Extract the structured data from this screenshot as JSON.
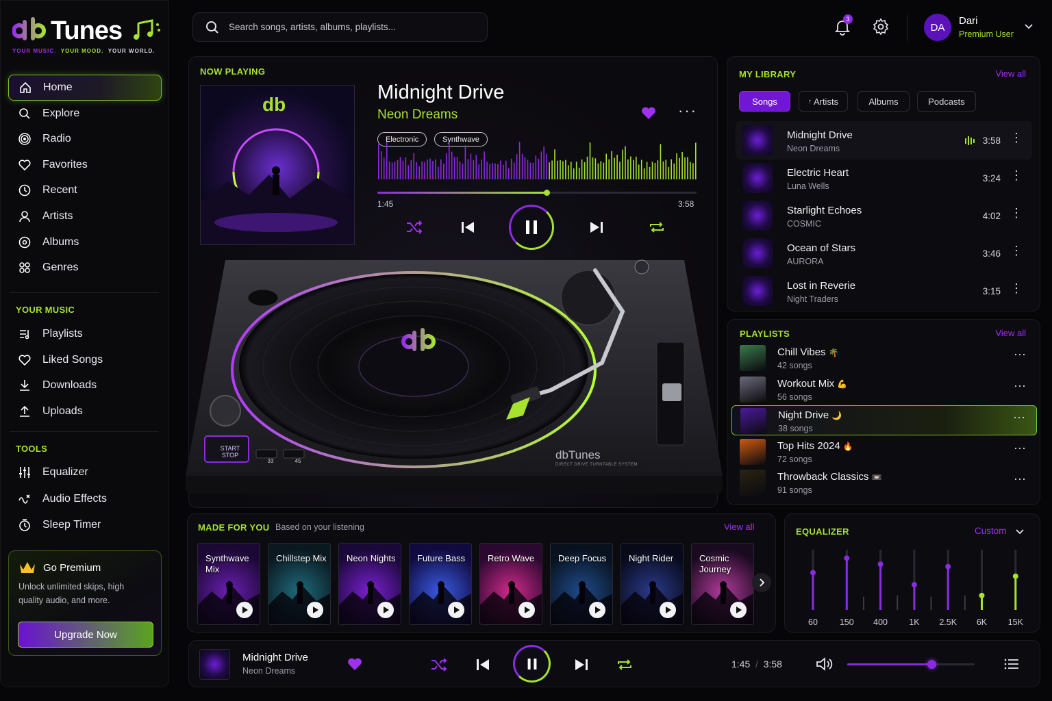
{
  "brand": {
    "name": "Tunes",
    "mark": "db",
    "tagline": [
      "YOUR MUSIC.",
      "YOUR MOOD.",
      "YOUR WORLD."
    ]
  },
  "sidebar": {
    "main_items": [
      {
        "label": "Home",
        "icon": "home-icon",
        "active": true
      },
      {
        "label": "Explore",
        "icon": "search-icon"
      },
      {
        "label": "Radio",
        "icon": "radio-icon"
      },
      {
        "label": "Favorites",
        "icon": "heart-icon"
      },
      {
        "label": "Recent",
        "icon": "clock-icon"
      },
      {
        "label": "Artists",
        "icon": "user-icon"
      },
      {
        "label": "Albums",
        "icon": "disc-icon"
      },
      {
        "label": "Genres",
        "icon": "grid-icon"
      }
    ],
    "your_music_title": "YOUR MUSIC",
    "your_music_items": [
      {
        "label": "Playlists",
        "icon": "playlist-icon"
      },
      {
        "label": "Liked Songs",
        "icon": "heart-icon"
      },
      {
        "label": "Downloads",
        "icon": "download-icon"
      },
      {
        "label": "Uploads",
        "icon": "upload-icon"
      }
    ],
    "tools_title": "TOOLS",
    "tools_items": [
      {
        "label": "Equalizer",
        "icon": "sliders-icon"
      },
      {
        "label": "Audio Effects",
        "icon": "audio-effects-icon"
      },
      {
        "label": "Sleep Timer",
        "icon": "timer-icon"
      }
    ],
    "premium": {
      "title": "Go Premium",
      "description": "Unlock unlimited skips, high quality audio, and more.",
      "button": "Upgrade Now"
    }
  },
  "header": {
    "search_placeholder": "Search songs, artists, albums, playlists...",
    "notification_count": "3",
    "user": {
      "initials": "DA",
      "name": "Dari",
      "role": "Premium User"
    }
  },
  "now_playing": {
    "label": "NOW PLAYING",
    "title": "Midnight Drive",
    "artist": "Neon Dreams",
    "tags": [
      "Electronic",
      "Synthwave"
    ],
    "elapsed": "1:45",
    "duration": "3:58",
    "progress": 0.53,
    "liked": true,
    "cover_mark": "db"
  },
  "turntable": {
    "brand": "dbTunes",
    "subtitle": "DIRECT DRIVE TURNTABLE SYSTEM",
    "start_stop": [
      "START",
      "STOP"
    ],
    "speeds": [
      "33",
      "45"
    ],
    "label_mark": "db"
  },
  "library": {
    "title": "MY LIBRARY",
    "view_all": "View all",
    "tabs": [
      {
        "label": "Songs",
        "active": true
      },
      {
        "label": "Artists"
      },
      {
        "label": "Albums"
      },
      {
        "label": "Podcasts"
      }
    ],
    "songs": [
      {
        "title": "Midnight Drive",
        "artist": "Neon Dreams",
        "duration": "3:58",
        "playing": true
      },
      {
        "title": "Electric Heart",
        "artist": "Luna Wells",
        "duration": "3:24"
      },
      {
        "title": "Starlight Echoes",
        "artist": "COSMIC",
        "duration": "4:02"
      },
      {
        "title": "Ocean of Stars",
        "artist": "AURORA",
        "duration": "3:46"
      },
      {
        "title": "Lost in Reverie",
        "artist": "Night Traders",
        "duration": "3:15"
      }
    ]
  },
  "playlists": {
    "title": "PLAYLISTS",
    "view_all": "View all",
    "items": [
      {
        "name": "Chill Vibes",
        "emoji": "🌴",
        "count": "42 songs",
        "color": "#3a7a4a"
      },
      {
        "name": "Workout Mix",
        "emoji": "💪",
        "count": "56 songs",
        "color": "#6a6a78"
      },
      {
        "name": "Night Drive",
        "emoji": "🌙",
        "count": "38 songs",
        "color": "#4b1a9a",
        "active": true
      },
      {
        "name": "Top Hits 2024",
        "emoji": "🔥",
        "count": "72 songs",
        "color": "#d05a10"
      },
      {
        "name": "Throwback Classics",
        "emoji": "📼",
        "count": "91 songs",
        "color": "#2a2410"
      }
    ]
  },
  "made_for_you": {
    "title": "MADE FOR YOU",
    "subtitle": "Based on your listening",
    "view_all": "View all",
    "cards": [
      {
        "name": "Synthwave Mix",
        "c1": "#6a1fb0",
        "c2": "#1b0834"
      },
      {
        "name": "Chillstep Mix",
        "c1": "#1f6a7a",
        "c2": "#0a1820"
      },
      {
        "name": "Neon Nights",
        "c1": "#7a20d0",
        "c2": "#1a0838"
      },
      {
        "name": "Future Bass",
        "c1": "#3a5ae0",
        "c2": "#100a40"
      },
      {
        "name": "Retro Wave",
        "c1": "#d02a8a",
        "c2": "#2a0830"
      },
      {
        "name": "Deep Focus",
        "c1": "#1f4a8a",
        "c2": "#08121e"
      },
      {
        "name": "Night Rider",
        "c1": "#2a3a8a",
        "c2": "#080a1a"
      },
      {
        "name": "Cosmic Journey",
        "c1": "#b03a9a",
        "c2": "#1a0a20"
      }
    ]
  },
  "equalizer": {
    "title": "EQUALIZER",
    "preset": "Custom",
    "bands": [
      {
        "label": "60",
        "level": 0.62,
        "color": "#8a2be2"
      },
      {
        "label": "150",
        "level": 0.86,
        "color": "#8a2be2"
      },
      {
        "label": "400",
        "level": 0.76,
        "color": "#8a2be2"
      },
      {
        "label": "1K",
        "level": 0.42,
        "color": "#8a2be2"
      },
      {
        "label": "2.5K",
        "level": 0.72,
        "color": "#8a2be2"
      },
      {
        "label": "6K",
        "level": 0.24,
        "color": "#a6e22e"
      },
      {
        "label": "15K",
        "level": 0.56,
        "color": "#a6e22e"
      }
    ],
    "extra_bands": [
      0.22,
      0.24,
      0.22,
      0.24,
      0.2
    ]
  },
  "player_bar": {
    "title": "Midnight Drive",
    "artist": "Neon Dreams",
    "elapsed": "1:45",
    "separator": "/",
    "duration": "3:58",
    "volume": 0.66,
    "liked": true
  },
  "colors": {
    "accent_green": "#a6e22e",
    "accent_purple": "#8a2be2",
    "background": "#060608"
  }
}
